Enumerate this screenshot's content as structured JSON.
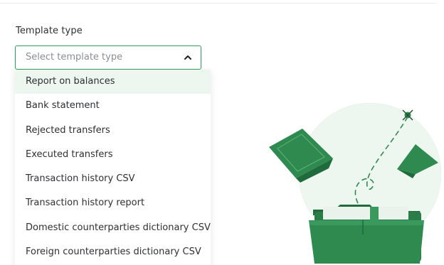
{
  "form": {
    "label": "Template type",
    "select": {
      "placeholder": "Select template type"
    },
    "options": [
      "Report on balances",
      "Bank statement",
      "Rejected transfers",
      "Executed transfers",
      "Transaction history CSV",
      "Transaction history report",
      "Domestic counterparties dictionary CSV",
      "Foreign counterparties dictionary CSV"
    ]
  },
  "colors": {
    "accent": "#2e9e5b",
    "highlight": "#eef6f0",
    "illustration_green": "#2f8a50"
  },
  "icons": {
    "select_chevron": "chevron-up-icon",
    "illustration": "folder-with-money-illustration"
  }
}
